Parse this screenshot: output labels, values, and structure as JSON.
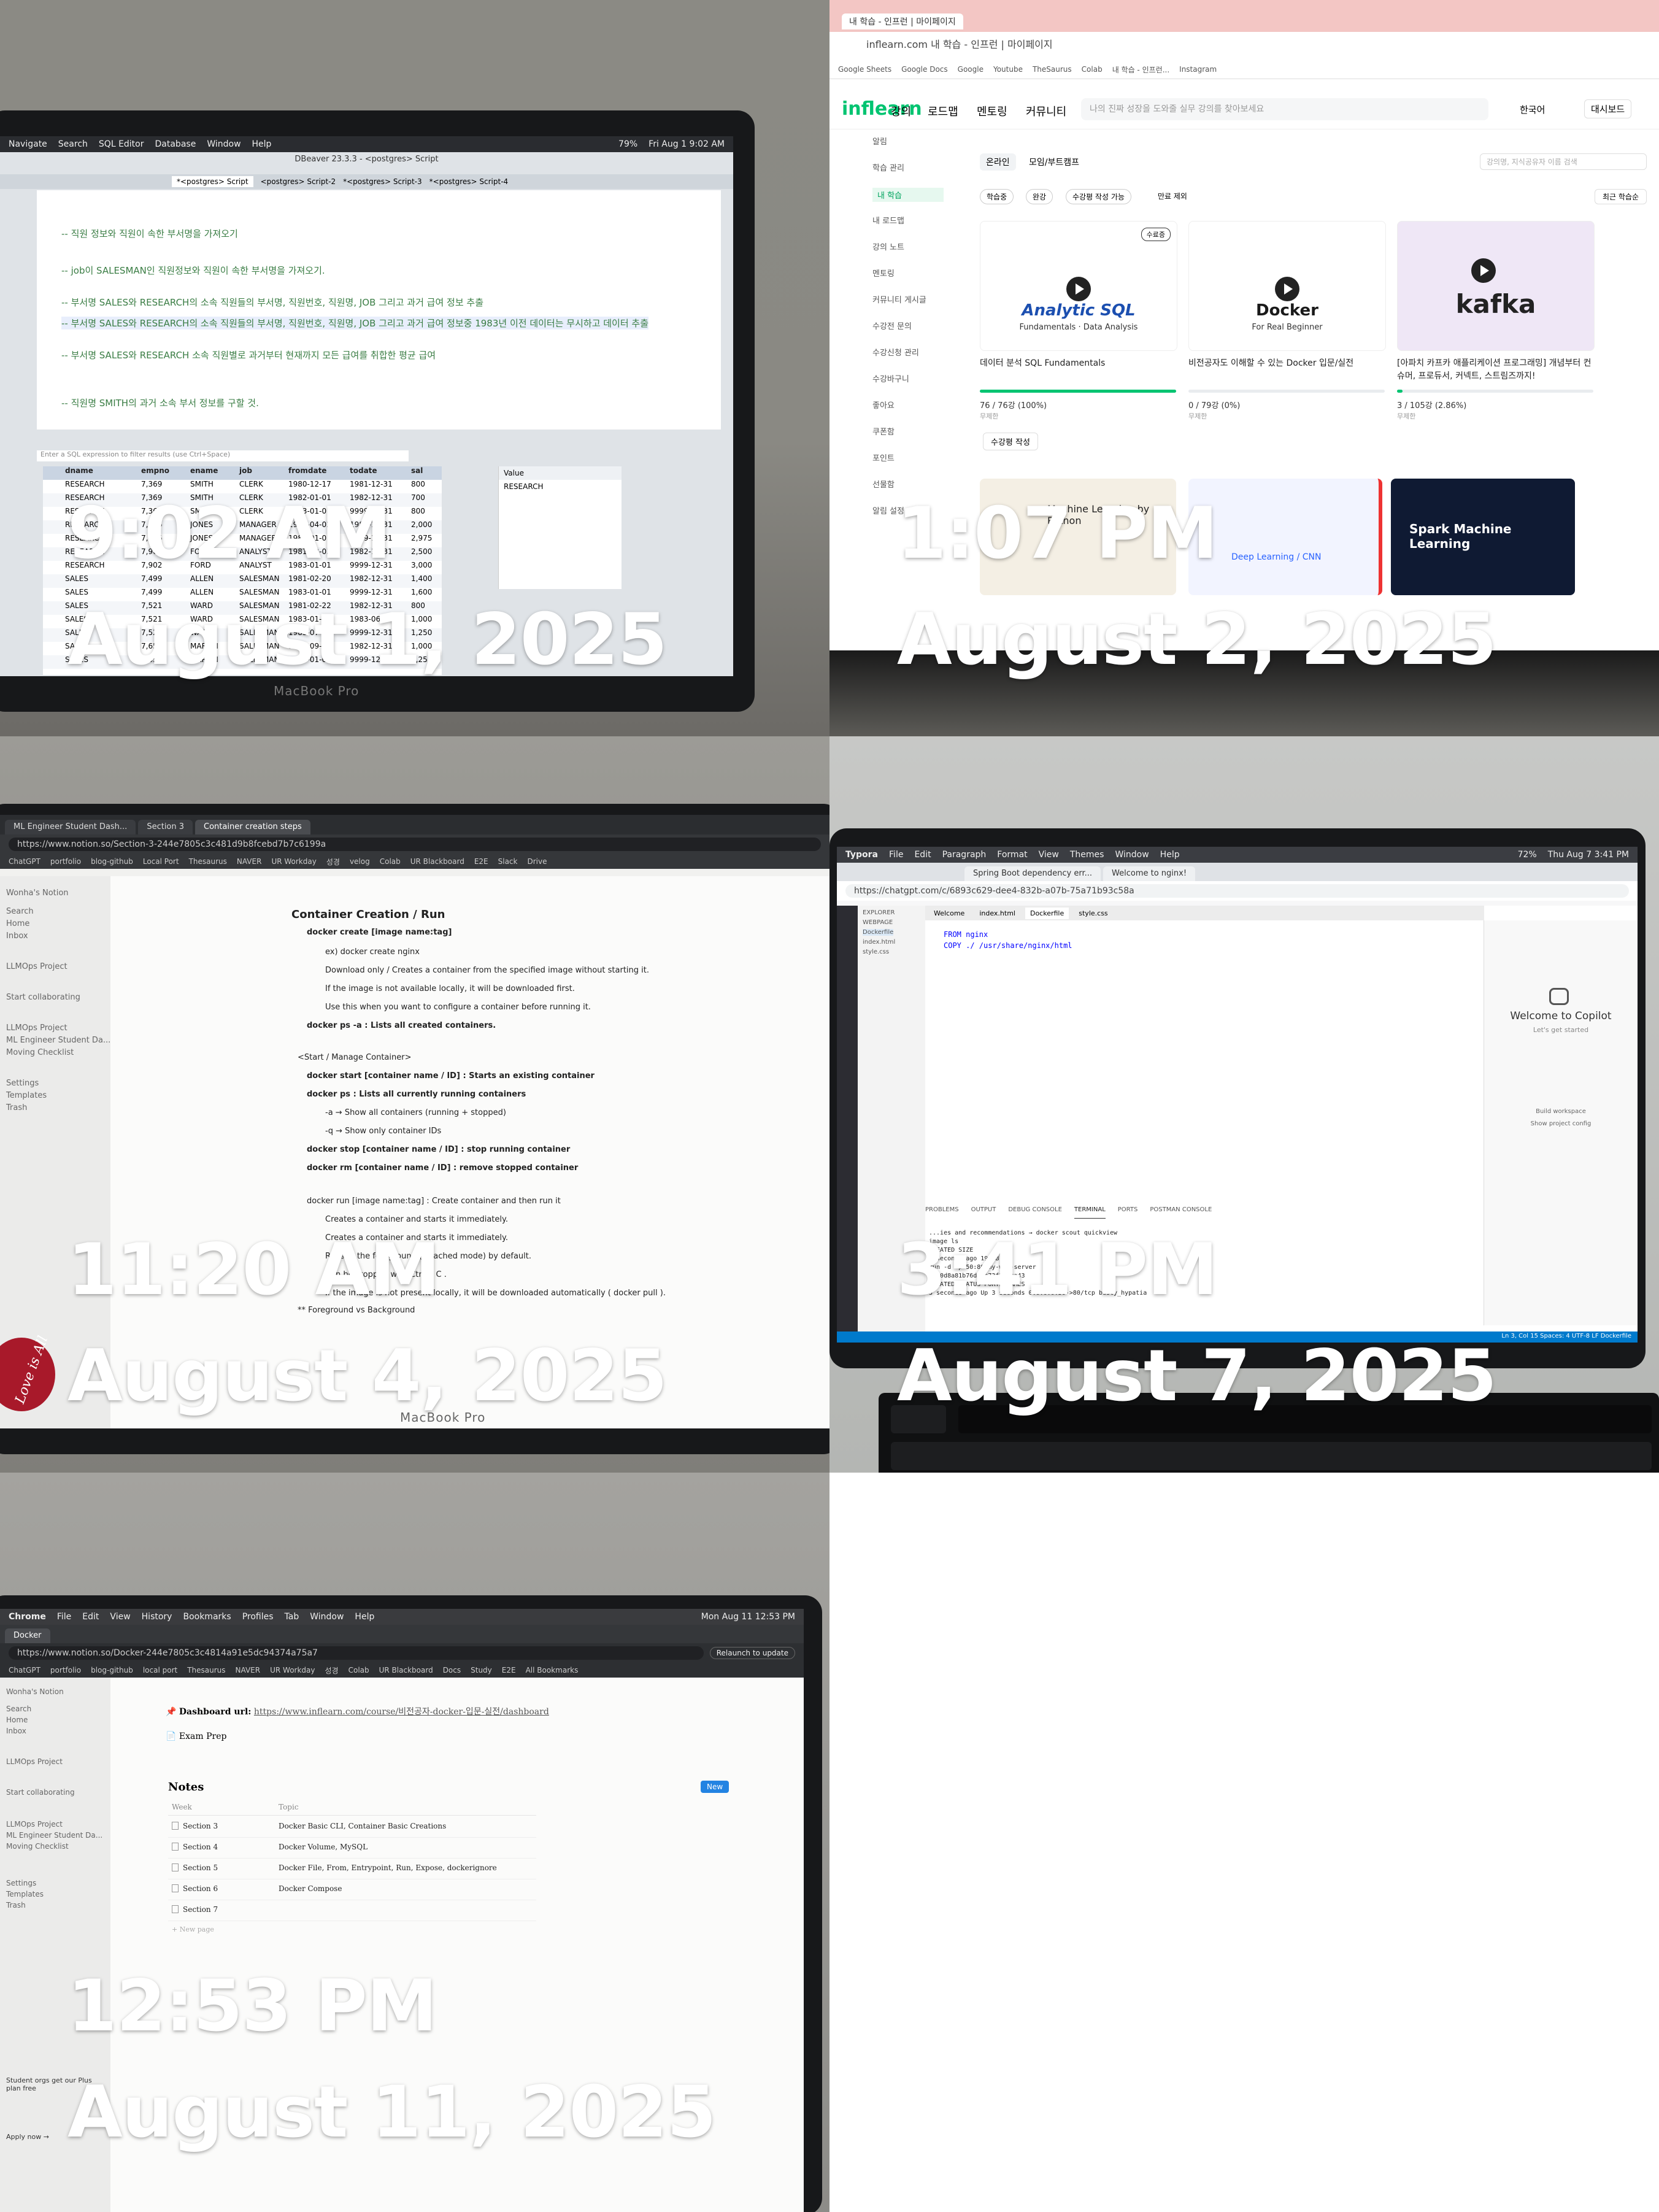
{
  "tiles": [
    {
      "caption": {
        "time": "9:02 AM",
        "date": "August 1, 2025"
      },
      "laptop_brand": "MacBook Pro",
      "screen": {
        "app_title": "DBeaver 23.3.3 - <postgres> Script",
        "menu": [
          "Navigate",
          "Search",
          "SQL Editor",
          "Database",
          "Window",
          "Help"
        ],
        "clock": "Fri Aug 1  9:02 AM",
        "battery": "79%",
        "tabs": [
          "*<postgres> Script",
          "<postgres> Script-2",
          "*<postgres> Script-3",
          "*<postgres> Script-4"
        ],
        "editor_lines": [
          "-- 직원 정보와 직원이 속한 부서명을 가져오기",
          "-- job이 SALESMAN인 직원정보와 직원이 속한 부서명을 가져오기.",
          "-- 부서명 SALES와 RESEARCH의 소속 직원들의 부서명, 직원번호, 직원명, JOB 그리고 과거 급여 정보 추출",
          "-- 부서명 SALES와 RESEARCH의 소속 직원들의 부서명, 직원번호, 직원명, JOB 그리고 과거 급여 정보중 1983년 이전 데이터는 무시하고 데이터 추출",
          "-- 부서명 SALES와 RESEARCH 소속 직원별로 과거부터 현재까지 모든 급여를 취합한 평균 급여",
          "-- 직원명 SMITH의 과거 소속 부서 정보를 구할 것."
        ],
        "results_columns": [
          "dname",
          "empno",
          "ename",
          "job",
          "fromdate",
          "todate",
          "sal"
        ],
        "results_rows": [
          [
            "RESEARCH",
            "7,369",
            "SMITH",
            "CLERK",
            "1980-12-17",
            "1981-12-31",
            "800"
          ],
          [
            "RESEARCH",
            "7,369",
            "SMITH",
            "CLERK",
            "1982-01-01",
            "1982-12-31",
            "700"
          ],
          [
            "RESEARCH",
            "7,369",
            "SMITH",
            "CLERK",
            "1983-01-01",
            "9999-12-31",
            "800"
          ],
          [
            "RESEARCH",
            "7,566",
            "JONES",
            "MANAGER",
            "1981-04-02",
            "1982-12-31",
            "2,000"
          ],
          [
            "RESEARCH",
            "7,566",
            "JONES",
            "MANAGER",
            "1983-01-01",
            "9999-12-31",
            "2,975"
          ],
          [
            "RESEARCH",
            "7,902",
            "FORD",
            "ANALYST",
            "1981-12-03",
            "1982-12-31",
            "2,500"
          ],
          [
            "RESEARCH",
            "7,902",
            "FORD",
            "ANALYST",
            "1983-01-01",
            "9999-12-31",
            "3,000"
          ],
          [
            "SALES",
            "7,499",
            "ALLEN",
            "SALESMAN",
            "1981-02-20",
            "1982-12-31",
            "1,400"
          ],
          [
            "SALES",
            "7,499",
            "ALLEN",
            "SALESMAN",
            "1983-01-01",
            "9999-12-31",
            "1,600"
          ],
          [
            "SALES",
            "7,521",
            "WARD",
            "SALESMAN",
            "1981-02-22",
            "1982-12-31",
            "800"
          ],
          [
            "SALES",
            "7,521",
            "WARD",
            "SALESMAN",
            "1983-01-01",
            "1983-06-30",
            "1,000"
          ],
          [
            "SALES",
            "7,521",
            "WARD",
            "SALESMAN",
            "1983-07-01",
            "9999-12-31",
            "1,250"
          ],
          [
            "SALES",
            "7,654",
            "MARTIN",
            "SALESMAN",
            "1981-09-28",
            "1982-12-31",
            "1,000"
          ],
          [
            "SALES",
            "7,654",
            "MARTIN",
            "SALESMAN",
            "1983-01-01",
            "9999-12-31",
            "1,250"
          ]
        ],
        "value_panel_label": "Value",
        "value_panel_value": "RESEARCH",
        "filter_placeholder": "Enter a SQL expression to filter results (use Ctrl+Space)"
      }
    },
    {
      "caption": {
        "time": "1:07 PM",
        "date": "August 2, 2025"
      },
      "screen": {
        "tab_title": "내 학습 - 인프런 | 마이페이지",
        "url": "inflearn.com 내 학습 - 인프런 | 마이페이지",
        "bookmarks": [
          "Google Sheets",
          "Google Docs",
          "Google",
          "Youtube",
          "TheSaurus",
          "Colab",
          "내 학습 - 인프런...",
          "Instagram"
        ],
        "logo": "inflearn",
        "nav": [
          "강의",
          "로드맵",
          "멘토링",
          "커뮤니티"
        ],
        "search_placeholder": "나의 진짜 성장을 도와줄 실무 강의를 찾아보세요",
        "lang": "한국어",
        "dashboard": "대시보드",
        "sidebar": [
          "알림",
          "학습 관리",
          "내 학습",
          "내 로드맵",
          "강의 노트",
          "멘토링",
          "커뮤니티 게시글",
          "수강전 문의",
          "수강신청 관리",
          "수강바구니",
          "좋아요",
          "쿠폰함",
          "포인트",
          "선물함",
          "알림 설정"
        ],
        "filter_tabs": [
          "온라인",
          "모임/부트캠프"
        ],
        "chips": [
          "학습중",
          "완강",
          "수강평 작성 가능"
        ],
        "exclude_free": "만료 제외",
        "sort": "최근 학습순",
        "search_field_placeholder": "강의명, 지식공유자 이름 검색",
        "courses": [
          {
            "title": "데이터 분석 SQL Fundamentals",
            "thumb_title": "Analytic SQL",
            "thumb_sub": "Fundamentals · Data Analysis",
            "progress_text": "76 / 76강 (100%)",
            "progress": 1.0,
            "period": "무제한",
            "badge": "수료증"
          },
          {
            "title": "비전공자도 이해할 수 있는 Docker 입문/실전",
            "thumb_title": "Docker",
            "thumb_sub": "For Real Beginner",
            "progress_text": "0 / 79강 (0%)",
            "progress": 0.0,
            "period": "무제한"
          },
          {
            "title": "[아파치 카프카 애플리케이션 프로그래밍] 개념부터 컨슈머, 프로듀서, 커넥트, 스트림즈까지!",
            "thumb_title": "kafka",
            "progress_text": "3 / 105강 (2.86%)",
            "progress": 0.0286,
            "period": "무제한"
          }
        ],
        "write_review": "수강평 작성",
        "second_row": [
          "Machine Learning by Python",
          "Deep Learning / CNN",
          "Spark Machine Learning"
        ]
      }
    },
    {
      "caption": {
        "time": "11:20 AM",
        "date": "August 4, 2025"
      },
      "laptop_brand": "MacBook Pro",
      "screen": {
        "tabs": [
          "ML Engineer Student Dash...",
          "Section 3",
          "Container creation steps"
        ],
        "url": "https://www.notion.so/Section-3-244e7805c3c481d9b8fcebd7b7c6199a",
        "bookmarks": [
          "ChatGPT",
          "portfolio",
          "blog-github",
          "Local Port",
          "Thesaurus",
          "NAVER",
          "UR Workday",
          "성경",
          "velog",
          "Colab",
          "UR Blackboard",
          "E2E",
          "Slack",
          "Drive"
        ],
        "sidebar": [
          "Wonha's Notion",
          "Search",
          "Home",
          "Inbox",
          "LLMOps Project",
          "Start collaborating",
          "LLMOps Project",
          "ML Engineer Student Da...",
          "Moving Checklist",
          "Settings",
          "Templates",
          "Trash"
        ],
        "heading": "Container Creation / Run",
        "lines": [
          "docker create [image name:tag]",
          "ex) docker create nginx",
          "Download only / Creates a container from the specified image without starting it.",
          "If the image is not available locally, it will be downloaded first.",
          "Use this when you want to configure a container before running it.",
          "docker ps -a : Lists all created containers.",
          "<Start / Manage Container>",
          "docker start [container name / ID] : Starts an existing container",
          "docker ps : Lists all currently running containers",
          "-a → Show all containers (running + stopped)",
          "-q → Show only container IDs",
          "docker stop [container name / ID] : stop running container",
          "docker rm [container name / ID] : remove stopped container",
          "docker run [image name:tag] : Create container and then run it",
          "Creates a container and starts it immediately.",
          "Creates a container and starts it immediately.",
          "Runs in the foreground (attached mode) by default.",
          "Can be stopped with  Ctrl + C .",
          "If the image is not present locally, it will be downloaded automatically ( docker pull ).",
          "** Foreground vs Background"
        ],
        "sticker_text": "Love is All"
      }
    },
    {
      "caption": {
        "time": "3:41 PM",
        "date": "August 7, 2025"
      },
      "screen": {
        "menu": [
          "Typora",
          "File",
          "Edit",
          "Paragraph",
          "Format",
          "View",
          "Themes",
          "Window",
          "Help"
        ],
        "clock": "Thu Aug 7  3:41 PM",
        "battery": "72%",
        "browser_tabs": [
          "Spring Boot dependency err...",
          "Welcome to nginx!"
        ],
        "url": "https://chatgpt.com/c/6893c629-dee4-832b-a07b-75a71b93c58a",
        "editor_tabs": [
          "Welcome",
          "index.html",
          "Dockerfile",
          "style.css"
        ],
        "explorer_items": [
          "EXPLORER",
          "WEBPAGE",
          "Dockerfile",
          "index.html",
          "style.css"
        ],
        "code_lines": [
          "FROM nginx",
          "COPY ./ /usr/share/nginx/html"
        ],
        "panel_tabs": [
          "PROBLEMS",
          "OUTPUT",
          "DEBUG CONSOLE",
          "TERMINAL",
          "PORTS",
          "POSTMAN CONSOLE"
        ],
        "terminal_lines": [
          "...ies and recommendations → docker scout quickview",
          "image ls",
          "   CREATED        SIZE",
          "   3 seconds ago   192MB",
          "run -d -p 50:80 my-web-server",
          "0a60d8a81b76d8fc73f3b9ca43",
          "CREATED         STATUS          PORTS                    NAMES",
          "3 seconds ago   Up 3 seconds    0.0.0.0:50->80/tcp       busty_hypatia"
        ],
        "copilot_title": "Welcome to Copilot",
        "copilot_sub": "Let's get started",
        "copilot_actions": [
          "Build workspace",
          "Show project config"
        ],
        "status_right": "Ln 3, Col 15   Spaces: 4   UTF-8   LF   Dockerfile"
      }
    },
    {
      "caption": {
        "time": "12:53 PM",
        "date": "August 11, 2025"
      },
      "screen": {
        "menu": [
          "Chrome",
          "File",
          "Edit",
          "View",
          "History",
          "Bookmarks",
          "Profiles",
          "Tab",
          "Window",
          "Help"
        ],
        "clock": "Mon Aug 11  12:53 PM",
        "tab_title": "Docker",
        "url": "https://www.notion.so/Docker-244e7805c3c4814a91e5dc94374a75a7",
        "relaunch": "Relaunch to update",
        "bookmarks": [
          "ChatGPT",
          "portfolio",
          "blog-github",
          "local port",
          "Thesaurus",
          "NAVER",
          "UR Workday",
          "성경",
          "Colab",
          "UR Blackboard",
          "Docs",
          "Study",
          "E2E",
          "All Bookmarks"
        ],
        "sidebar": [
          "Wonha's Notion",
          "Search",
          "Home",
          "Inbox",
          "LLMOps Project",
          "Start collaborating",
          "LLMOps Project",
          "ML Engineer Student Da...",
          "Moving Checklist",
          "Settings",
          "Templates",
          "Trash"
        ],
        "dashboard_url_label": "Dashboard url:",
        "dashboard_url": "https://www.inflearn.com/course/비전공자-docker-입문-실전/dashboard",
        "exam_prep": "Exam Prep",
        "notes_title": "Notes",
        "new_button": "New",
        "table_headers": [
          "Week",
          "Topic"
        ],
        "table_rows": [
          [
            "Section 3",
            "Docker Basic CLI, Container Basic Creations"
          ],
          [
            "Section 4",
            "Docker Volume, MySQL"
          ],
          [
            "Section 5",
            "Docker File, From, Entrypoint, Run, Expose, dockerignore"
          ],
          [
            "Section 6",
            "Docker Compose"
          ],
          [
            "Section 7",
            ""
          ]
        ],
        "new_page": "+ New page",
        "upsell": "Student orgs get our Plus plan free",
        "apply": "Apply now →"
      }
    }
  ],
  "colors": {
    "caption": "#ffffff",
    "inflearn_green": "#00c471",
    "notion_blue": "#2383e2",
    "vscode_blue": "#007acc"
  }
}
